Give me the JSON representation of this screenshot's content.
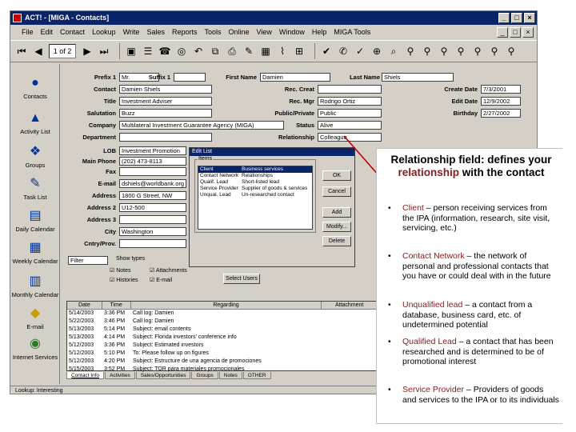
{
  "window": {
    "title": "ACT! - [MIGA - Contacts]",
    "buttons": [
      "_",
      "□",
      "×"
    ],
    "mdi_buttons": [
      "_",
      "□",
      "×"
    ]
  },
  "menu": [
    "File",
    "Edit",
    "Contact",
    "Lookup",
    "Write",
    "Sales",
    "Reports",
    "Tools",
    "Online",
    "View",
    "Window",
    "Help",
    "MIGA Tools"
  ],
  "toolbar": {
    "pager": "1 of 2"
  },
  "sidebar": [
    {
      "label": "Contacts",
      "icon": "contacts-icon"
    },
    {
      "label": "Activity List",
      "icon": "activity-list-icon"
    },
    {
      "label": "Groups",
      "icon": "groups-icon"
    },
    {
      "label": "Task List",
      "icon": "task-list-icon"
    },
    {
      "label": "Daily Calendar",
      "icon": "daily-calendar-icon"
    },
    {
      "label": "Weekly Calendar",
      "icon": "weekly-calendar-icon"
    },
    {
      "label": "Monthly Calendar",
      "icon": "monthly-calendar-icon"
    },
    {
      "label": "E-mail",
      "icon": "email-icon"
    },
    {
      "label": "Internet Services",
      "icon": "internet-services-icon"
    }
  ],
  "form": {
    "prefix_label": "Prefix 1",
    "prefix": "Mr.",
    "suffix_label": "Suffix 1",
    "suffix": "",
    "first_name_label": "First Name",
    "first_name": "Damien",
    "last_name_label": "Last Name",
    "last_name": "Shiels",
    "contact_label": "Contact",
    "contact": "Damien Shiels",
    "rec_creat_label": "Rec. Creat",
    "rec_creat": "",
    "create_date_label": "Create Date",
    "create_date": "7/3/2001",
    "title_label": "Title",
    "title": "Investment Adviser",
    "rec_mgr_label": "Rec. Mgr",
    "rec_mgr": "Rodrigo Ortiz",
    "edit_date_label": "Edit Date",
    "edit_date": "12/9/2002",
    "salutation_label": "Salutation",
    "salutation": "Buzz",
    "public_private_label": "Public/Private",
    "public_private": "Public",
    "birthday_label": "Birthday",
    "birthday": "2/27/2002",
    "company_label": "Company",
    "company": "Multilateral Investment Guarantee Agency (MIGA)",
    "status_label": "Status",
    "status": "Alive",
    "department_label": "Department",
    "department": "",
    "relationship_label": "Relationship",
    "relationship": "Colleague",
    "lob_label": "LOB",
    "lob": "Investment Promotion",
    "main_phone_label": "Main Phone",
    "main_phone": "(202) 473-8113",
    "fax_label": "Fax",
    "fax": "",
    "email_label": "E-mail",
    "email": "dshiels@worldbank.org",
    "address_label": "Address",
    "address": "1800 G Street, NW",
    "address2_label": "Address 2",
    "address2": "U12-500",
    "address3_label": "Address 3",
    "address3": "",
    "city_label": "City",
    "city": "Washington",
    "country_label": "Cntry/Prov.",
    "country": ""
  },
  "dialog": {
    "title": "Edit List",
    "items_label": "Items",
    "items": [
      {
        "name": "Client",
        "desc": "Business services",
        "selected": true
      },
      {
        "name": "Contact Network",
        "desc": "Relationships",
        "selected": false
      },
      {
        "name": "Qualif. Lead",
        "desc": "Short-listed lead",
        "selected": false
      },
      {
        "name": "Service Provider",
        "desc": "Supplier of goods & services",
        "selected": false
      },
      {
        "name": "Unqual. Lead",
        "desc": "Un-researched contact",
        "selected": false
      }
    ],
    "buttons": [
      "OK",
      "Cancel",
      "Add",
      "Modify...",
      "Delete"
    ]
  },
  "filter": {
    "label": "Filter",
    "show_types": "Show types",
    "checks": [
      "Notes",
      "Attachments",
      "Histories",
      "E-mail"
    ],
    "select_users": "Select Users"
  },
  "grid": {
    "columns": [
      "Date",
      "Time",
      "Regarding",
      "Attachment"
    ],
    "rows": [
      [
        "5/14/2003",
        "3:36 PM",
        "Call log: Damien",
        ""
      ],
      [
        "5/22/2003",
        "3:46 PM",
        "Call log: Damien",
        ""
      ],
      [
        "5/13/2003",
        "5:14 PM",
        "Subject: email contents",
        ""
      ],
      [
        "5/13/2003",
        "4:14 PM",
        "Subject: Florida investors' conference info",
        ""
      ],
      [
        "5/12/2003",
        "3:36 PM",
        "Subject: Estimated investors",
        ""
      ],
      [
        "5/12/2003",
        "5:10 PM",
        "To: Please follow up on figures",
        ""
      ],
      [
        "5/12/2003",
        "4:20 PM",
        "Subject: Estructure de una agencia de promociones",
        ""
      ],
      [
        "5/15/2003",
        "3:52 PM",
        "Subject: TOR para materiales promocionales",
        ""
      ]
    ]
  },
  "tabs": [
    "Contact Info",
    "Activities",
    "Sales/Opportunities",
    "Groups",
    "Notes",
    "OTHER"
  ],
  "status_bar": "Lookup: Interesting",
  "callout": {
    "title_prefix": "Relationship field: defines your",
    "title_highlight": "relationship",
    "title_suffix": "with the contact",
    "bullets": [
      {
        "term": "Client",
        "text": " – person receiving services from the IPA (information, research, site visit, servicing, etc.)"
      },
      {
        "term": "Contact Network",
        "text": " – the network of personal and professional contacts that you have or could deal with in the future"
      },
      {
        "term": "Unqualified lead",
        "text": " – a contact from a database, business card, etc. of undetermined potential"
      },
      {
        "term": "Qualified Lead",
        "text": " – a contact that has been researched and is determined to be of promotional interest"
      },
      {
        "term": "Service Provider",
        "text": " – Providers of goods and services to the IPA or to its individuals"
      }
    ],
    "accent_color": "#8b1a1a"
  }
}
